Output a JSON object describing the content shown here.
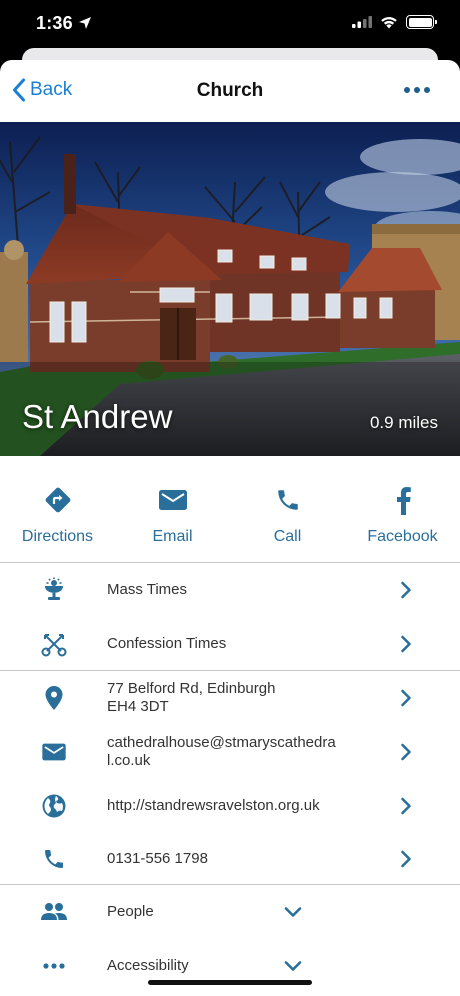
{
  "status_bar": {
    "time": "1:36"
  },
  "nav": {
    "back_label": "Back",
    "title": "Church"
  },
  "hero": {
    "name": "St Andrew",
    "distance": "0.9 miles"
  },
  "actions": [
    {
      "label": "Directions",
      "icon": "directions-icon"
    },
    {
      "label": "Email",
      "icon": "email-icon"
    },
    {
      "label": "Call",
      "icon": "phone-icon"
    },
    {
      "label": "Facebook",
      "icon": "facebook-icon"
    }
  ],
  "times": [
    {
      "label": "Mass Times",
      "icon": "chalice-icon"
    },
    {
      "label": "Confession Times",
      "icon": "keys-icon"
    }
  ],
  "contact": {
    "address_line1": "77 Belford Rd, Edinburgh",
    "address_line2": "EH4 3DT",
    "email_line1": "cathedralhouse@stmaryscathedra",
    "email_line2": "l.co.uk",
    "website": "http://standrewsravelston.org.uk",
    "phone": "0131-556 1798"
  },
  "more": [
    {
      "label": "People",
      "icon": "people-icon"
    },
    {
      "label": "Accessibility",
      "icon": "ellipsis-icon"
    }
  ],
  "colors": {
    "accent": "#1a7fd4",
    "icon": "#2a6f9a",
    "divider": "#c9c9cc"
  }
}
